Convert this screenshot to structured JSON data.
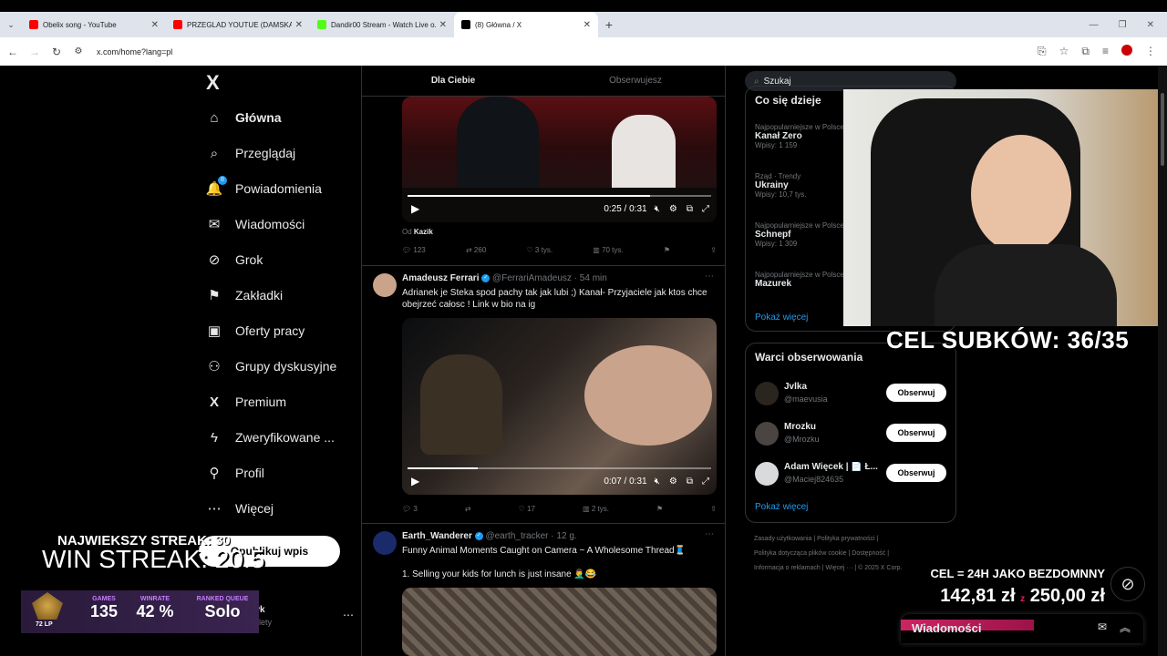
{
  "browser": {
    "tabs": [
      {
        "title": "Obelix song - YouTube",
        "color": "#ff0000"
      },
      {
        "title": "PRZEGLAD YOUTUE (DAMSKA...",
        "color": "#ff0000"
      },
      {
        "title": "Dandir00 Stream - Watch Live o...",
        "color": "#53fc18"
      },
      {
        "title": "(8) Główna / X",
        "color": "#000000"
      }
    ],
    "url": "x.com/home?lang=pl"
  },
  "sidebar": {
    "logo": "X",
    "items": [
      {
        "label": "Główna",
        "icon": "home-icon",
        "glyph": "⌂"
      },
      {
        "label": "Przeglądaj",
        "icon": "search-icon",
        "glyph": "⌕"
      },
      {
        "label": "Powiadomienia",
        "icon": "bell-icon",
        "glyph": "🔔",
        "badge": "8"
      },
      {
        "label": "Wiadomości",
        "icon": "mail-icon",
        "glyph": "✉"
      },
      {
        "label": "Grok",
        "icon": "grok-icon",
        "glyph": "⊘"
      },
      {
        "label": "Zakładki",
        "icon": "bookmark-icon",
        "glyph": "⚑"
      },
      {
        "label": "Oferty pracy",
        "icon": "briefcase-icon",
        "glyph": "💼"
      },
      {
        "label": "Grupy dyskusyjne",
        "icon": "people-icon",
        "glyph": "👥"
      },
      {
        "label": "Premium",
        "icon": "x-premium-icon",
        "glyph": "X"
      },
      {
        "label": "Zweryfikowane ...",
        "icon": "lightning-icon",
        "glyph": "⚡"
      },
      {
        "label": "Profil",
        "icon": "person-icon",
        "glyph": "👤"
      },
      {
        "label": "Więcej",
        "icon": "more-circle-icon",
        "glyph": "⋯"
      }
    ],
    "post_button": "Opublikuj wpis",
    "account_name": "Patryk",
    "account_sub": "lety"
  },
  "feed": {
    "tabs": [
      "Dla Ciebie",
      "Obserwujesz"
    ],
    "tweet1": {
      "time": "0:25 / 0:31",
      "progress": 0.8,
      "from_label": "Od",
      "from_name": "Kazik",
      "replies": "123",
      "retweets": "260",
      "likes": "3 tys.",
      "views": "70 tys."
    },
    "tweet2": {
      "name": "Amadeusz Ferrari",
      "handle": "@FerrariAmadeusz",
      "age": "54 min",
      "text": "Adrianek je Steka spod pachy tak jak lubi ;) Kanał- Przyjaciele jak ktos chce obejrzeć całosc ! Link w bio na ig",
      "time": "0:07 / 0:31",
      "progress": 0.23,
      "replies": "3",
      "retweets": "",
      "likes": "17",
      "views": "2 tys."
    },
    "tweet3": {
      "name": "Earth_Wanderer",
      "handle": "@earth_tracker",
      "age": "12 g.",
      "text": "Funny Animal Moments Caught on Camera ~ A Wholesome Thread🧵",
      "text2": "1. Selling your kids for lunch is just insane 🤦‍♂️😂"
    }
  },
  "right": {
    "search_placeholder": "Szukaj",
    "trends_title": "Co się dzieje",
    "trends": [
      {
        "sub": "Najpopularniejsze w Polsce",
        "title": "Kanał Zero",
        "count": "Wpisy: 1 159"
      },
      {
        "sub": "Rząd · Trendy",
        "title": "Ukrainy",
        "count": "Wpisy: 10,7 tys."
      },
      {
        "sub": "Najpopularniejsze w Polsce",
        "title": "Schnepf",
        "count": "Wpisy: 1 309"
      },
      {
        "sub": "Najpopularniejsze w Polsce",
        "title": "Mazurek",
        "count": ""
      }
    ],
    "show_more": "Pokaż więcej",
    "follow_title": "Warci obserwowania",
    "follow": [
      {
        "name": "Jvlka",
        "handle": "@maevusia"
      },
      {
        "name": "Mrozku",
        "handle": "@Mrozku"
      },
      {
        "name": "Adam Więcek | 📄 Ł...",
        "handle": "@Maciej824635"
      }
    ],
    "follow_button": "Obserwuj",
    "footer": [
      "Zasady użytkowania",
      "Polityka prywatności",
      "Polityka dotycząca plików cookie",
      "Dostępność",
      "Informacja o reklamach",
      "Więcej ···",
      "© 2025 X Corp."
    ],
    "dm_label": "Wiadomości"
  },
  "overlay": {
    "goal": "CEL SUBKÓW: 36/35",
    "streak_top": "NAJWIEKSZY STREAK: 30",
    "streak_main": "WIN STREAK: 20.5",
    "rank": {
      "lp": "72 LP",
      "games_label": "GAMES",
      "games": "135",
      "winrate_label": "WINRATE",
      "winrate": "42 %",
      "queue_label": "RANKED QUEUE",
      "queue": "Solo"
    },
    "donation_goal": "CEL = 24H JAKO BEZDOMNNY",
    "donation_current": "142,81 zł",
    "donation_sep": "z",
    "donation_target": "250,00 zł"
  }
}
